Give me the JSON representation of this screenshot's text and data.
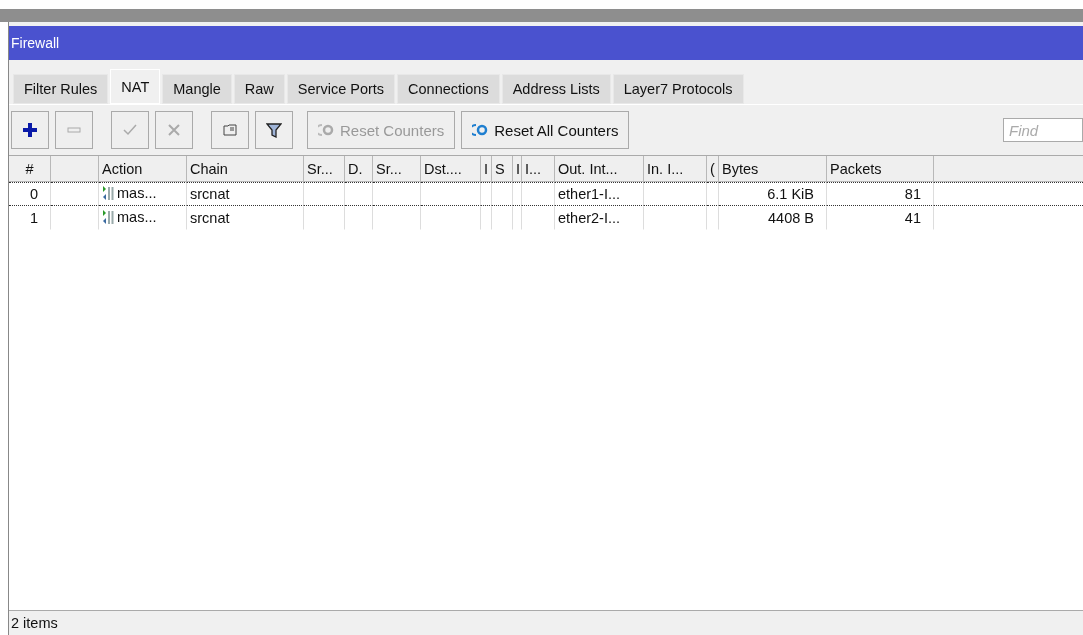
{
  "window": {
    "title": "Firewall"
  },
  "tabs": [
    {
      "label": "Filter Rules",
      "selected": false
    },
    {
      "label": "NAT",
      "selected": true
    },
    {
      "label": "Mangle",
      "selected": false
    },
    {
      "label": "Raw",
      "selected": false
    },
    {
      "label": "Service Ports",
      "selected": false
    },
    {
      "label": "Connections",
      "selected": false
    },
    {
      "label": "Address Lists",
      "selected": false
    },
    {
      "label": "Layer7 Protocols",
      "selected": false
    }
  ],
  "toolbar": [
    {
      "kind": "add",
      "disabled": false
    },
    {
      "kind": "remove",
      "disabled": true
    },
    {
      "kind": "enable",
      "disabled": true
    },
    {
      "kind": "disable",
      "disabled": true
    },
    {
      "kind": "comment",
      "disabled": false
    },
    {
      "kind": "filter",
      "disabled": false
    },
    {
      "kind": "text",
      "label": "Reset Counters",
      "disabled": true
    },
    {
      "kind": "text",
      "label": "Reset All Counters",
      "disabled": false
    }
  ],
  "search": {
    "placeholder": "Find"
  },
  "table": {
    "columns": [
      "#",
      "",
      "Action",
      "Chain",
      "Sr...",
      "D.",
      "Sr...",
      "Dst....",
      "I",
      "S",
      "I",
      "I...",
      "Out. Int...",
      "In. I...",
      "(",
      "Bytes",
      "Packets"
    ],
    "rows": [
      {
        "focused": true,
        "cells": [
          "0",
          "",
          "mas...",
          "srcnat",
          "",
          "",
          "",
          "",
          "",
          "",
          "",
          "",
          "ether1-I...",
          "",
          "",
          "6.1 KiB",
          "81"
        ]
      },
      {
        "focused": false,
        "cells": [
          "1",
          "",
          "mas...",
          "srcnat",
          "",
          "",
          "",
          "",
          "",
          "",
          "",
          "",
          "ether2-I...",
          "",
          "",
          "4408 B",
          "41"
        ]
      }
    ]
  },
  "status_bar": "2 items"
}
